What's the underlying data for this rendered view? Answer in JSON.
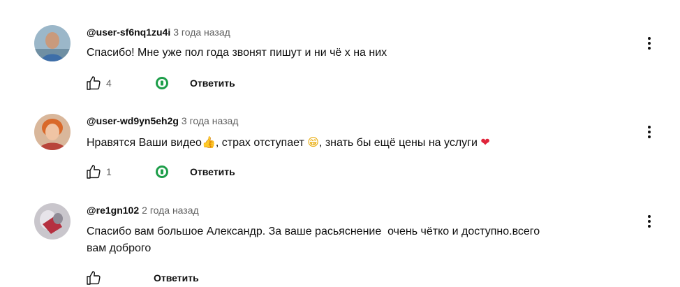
{
  "comments": [
    {
      "author": "@user-sf6nq1zu4i",
      "time": "3 года назад",
      "text": "Спасибо! Мне уже пол года звонят пишут и ни чё х на них",
      "likes": "4",
      "reply_label": "Ответить",
      "creator_heart": true
    },
    {
      "author": "@user-wd9yn5eh2g",
      "time": "3 года назад",
      "text_part1": "Нравятся Ваши видео",
      "emoji1": "👍",
      "text_part2": ", страх отступает",
      "emoji2": "😁",
      "text_part3": ", знать бы ещё цены на услуги",
      "emoji3": "❤",
      "likes": "1",
      "reply_label": "Ответить",
      "creator_heart": true
    },
    {
      "author": "@re1gn102",
      "time": "2 года назад",
      "text_line1": "Спасибо вам большое Александр. За ваше расьяснение  очень чётко и доступно.всего",
      "text_line2": "вам доброго",
      "likes": "",
      "reply_label": "Ответить",
      "creator_heart": false
    }
  ],
  "colors": {
    "text": "#0f0f0f",
    "secondary": "#606060",
    "creator_heart_badge": "#1e9e4a"
  }
}
